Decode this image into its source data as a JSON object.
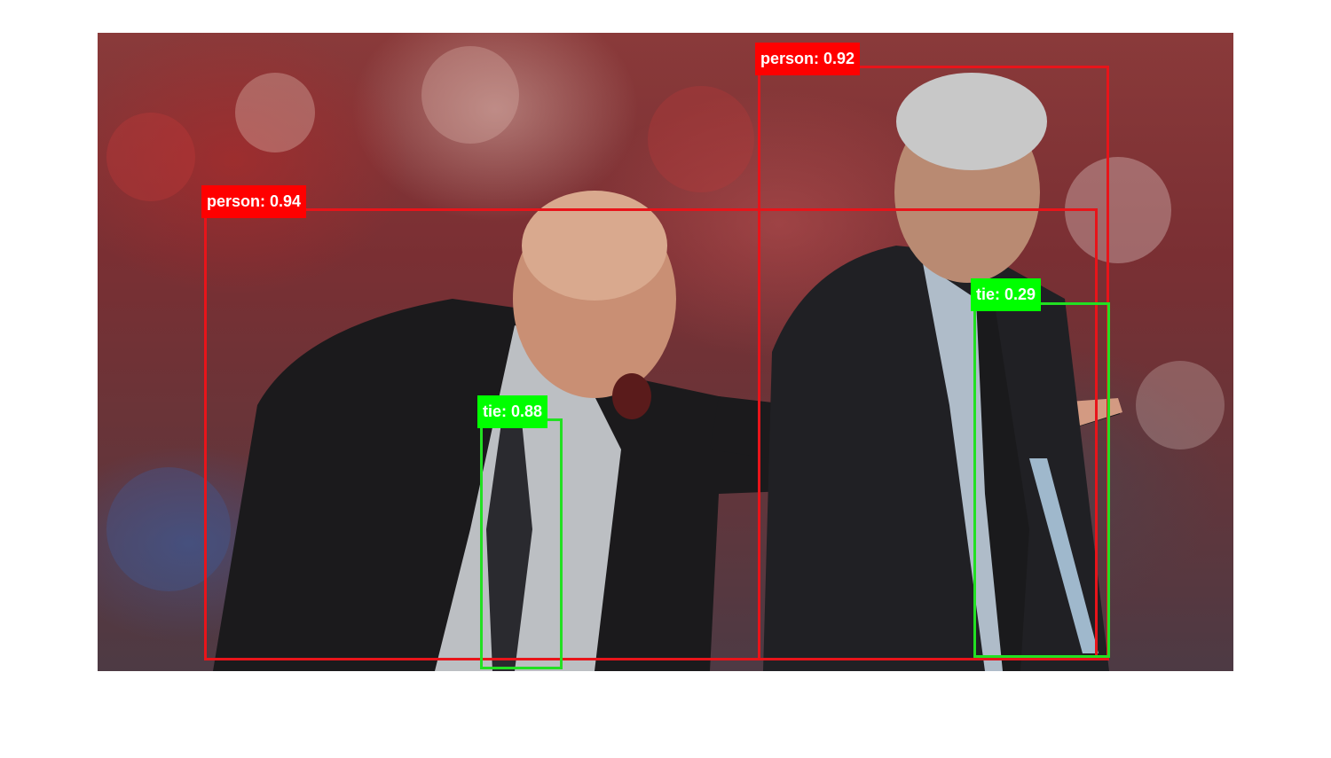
{
  "detections": [
    {
      "label": "person: 0.94",
      "class": "person",
      "score": 0.94,
      "color": "#ff0000"
    },
    {
      "label": "person: 0.92",
      "class": "person",
      "score": 0.92,
      "color": "#ff0000"
    },
    {
      "label": "tie: 0.88",
      "class": "tie",
      "score": 0.88,
      "color": "#00ff00"
    },
    {
      "label": "tie: 0.29",
      "class": "tie",
      "score": 0.29,
      "color": "#00ff00"
    }
  ]
}
